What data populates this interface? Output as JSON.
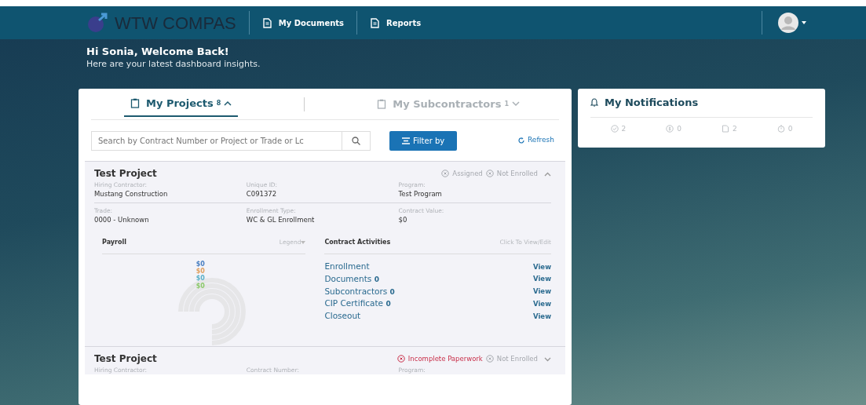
{
  "navbar": {
    "logo_text": "WTW COMPAS",
    "links": [
      {
        "label": "My Documents"
      },
      {
        "label": "Reports"
      }
    ]
  },
  "welcome": {
    "title": "Hi Sonia, Welcome Back!",
    "subtitle": "Here are your latest dashboard insights."
  },
  "tabs": [
    {
      "label": "My Projects",
      "count": "8",
      "selected": true,
      "expanded": true
    },
    {
      "label": "My Subcontractors",
      "count": "1",
      "selected": false,
      "expanded": false
    }
  ],
  "search": {
    "placeholder": "Search by Contract Number or Project or Trade or Lc"
  },
  "filter_button": "Filter by",
  "refresh": "Refresh",
  "projects": [
    {
      "title": "Test Project",
      "expanded": true,
      "statuses": [
        {
          "label": "Assigned",
          "kind": "neutral"
        },
        {
          "label": "Not Enrolled",
          "kind": "neutral"
        }
      ],
      "fields": [
        {
          "label": "Hiring Contractor:",
          "value": "Mustang Construction"
        },
        {
          "label": "Unique ID:",
          "value": "C091372"
        },
        {
          "label": "Program:",
          "value": "Test Program"
        },
        {
          "label": "Trade:",
          "value": "0000 - Unknown"
        },
        {
          "label": "Enrollment Type:",
          "value": "WC & GL Enrollment"
        },
        {
          "label": "Contract Value:",
          "value": "$0"
        }
      ],
      "payroll": {
        "title": "Payroll",
        "legend": "Legend",
        "values": [
          {
            "text": "$0",
            "color": "#4a7fc1"
          },
          {
            "text": "$0",
            "color": "#e0a060"
          },
          {
            "text": "$0",
            "color": "#5bb0c8"
          },
          {
            "text": "$0",
            "color": "#8cc96a"
          }
        ]
      },
      "activities": {
        "title": "Contract Activities",
        "hint": "Click To View/Edit",
        "items": [
          {
            "label": "Enrollment",
            "action": "View"
          },
          {
            "label": "Documents",
            "count": "0",
            "action": "View"
          },
          {
            "label": "Subcontractors",
            "count": "0",
            "action": "View"
          },
          {
            "label": "CIP Certificate",
            "count": "0",
            "action": "View"
          },
          {
            "label": "Closeout",
            "action": "View"
          }
        ]
      }
    },
    {
      "title": "Test Project",
      "expanded": false,
      "statuses": [
        {
          "label": "Incomplete Paperwork",
          "kind": "alert"
        },
        {
          "label": "Not Enrolled",
          "kind": "neutral"
        }
      ],
      "fields": [
        {
          "label": "Hiring Contractor:"
        },
        {
          "label": "Contract Number:"
        },
        {
          "label": "Program:"
        }
      ]
    }
  ],
  "notifications": {
    "title": "My Notifications",
    "counts": [
      {
        "kind": "check",
        "value": "2"
      },
      {
        "kind": "dollar",
        "value": "0"
      },
      {
        "kind": "document",
        "value": "2"
      },
      {
        "kind": "timer",
        "value": "0"
      }
    ]
  }
}
